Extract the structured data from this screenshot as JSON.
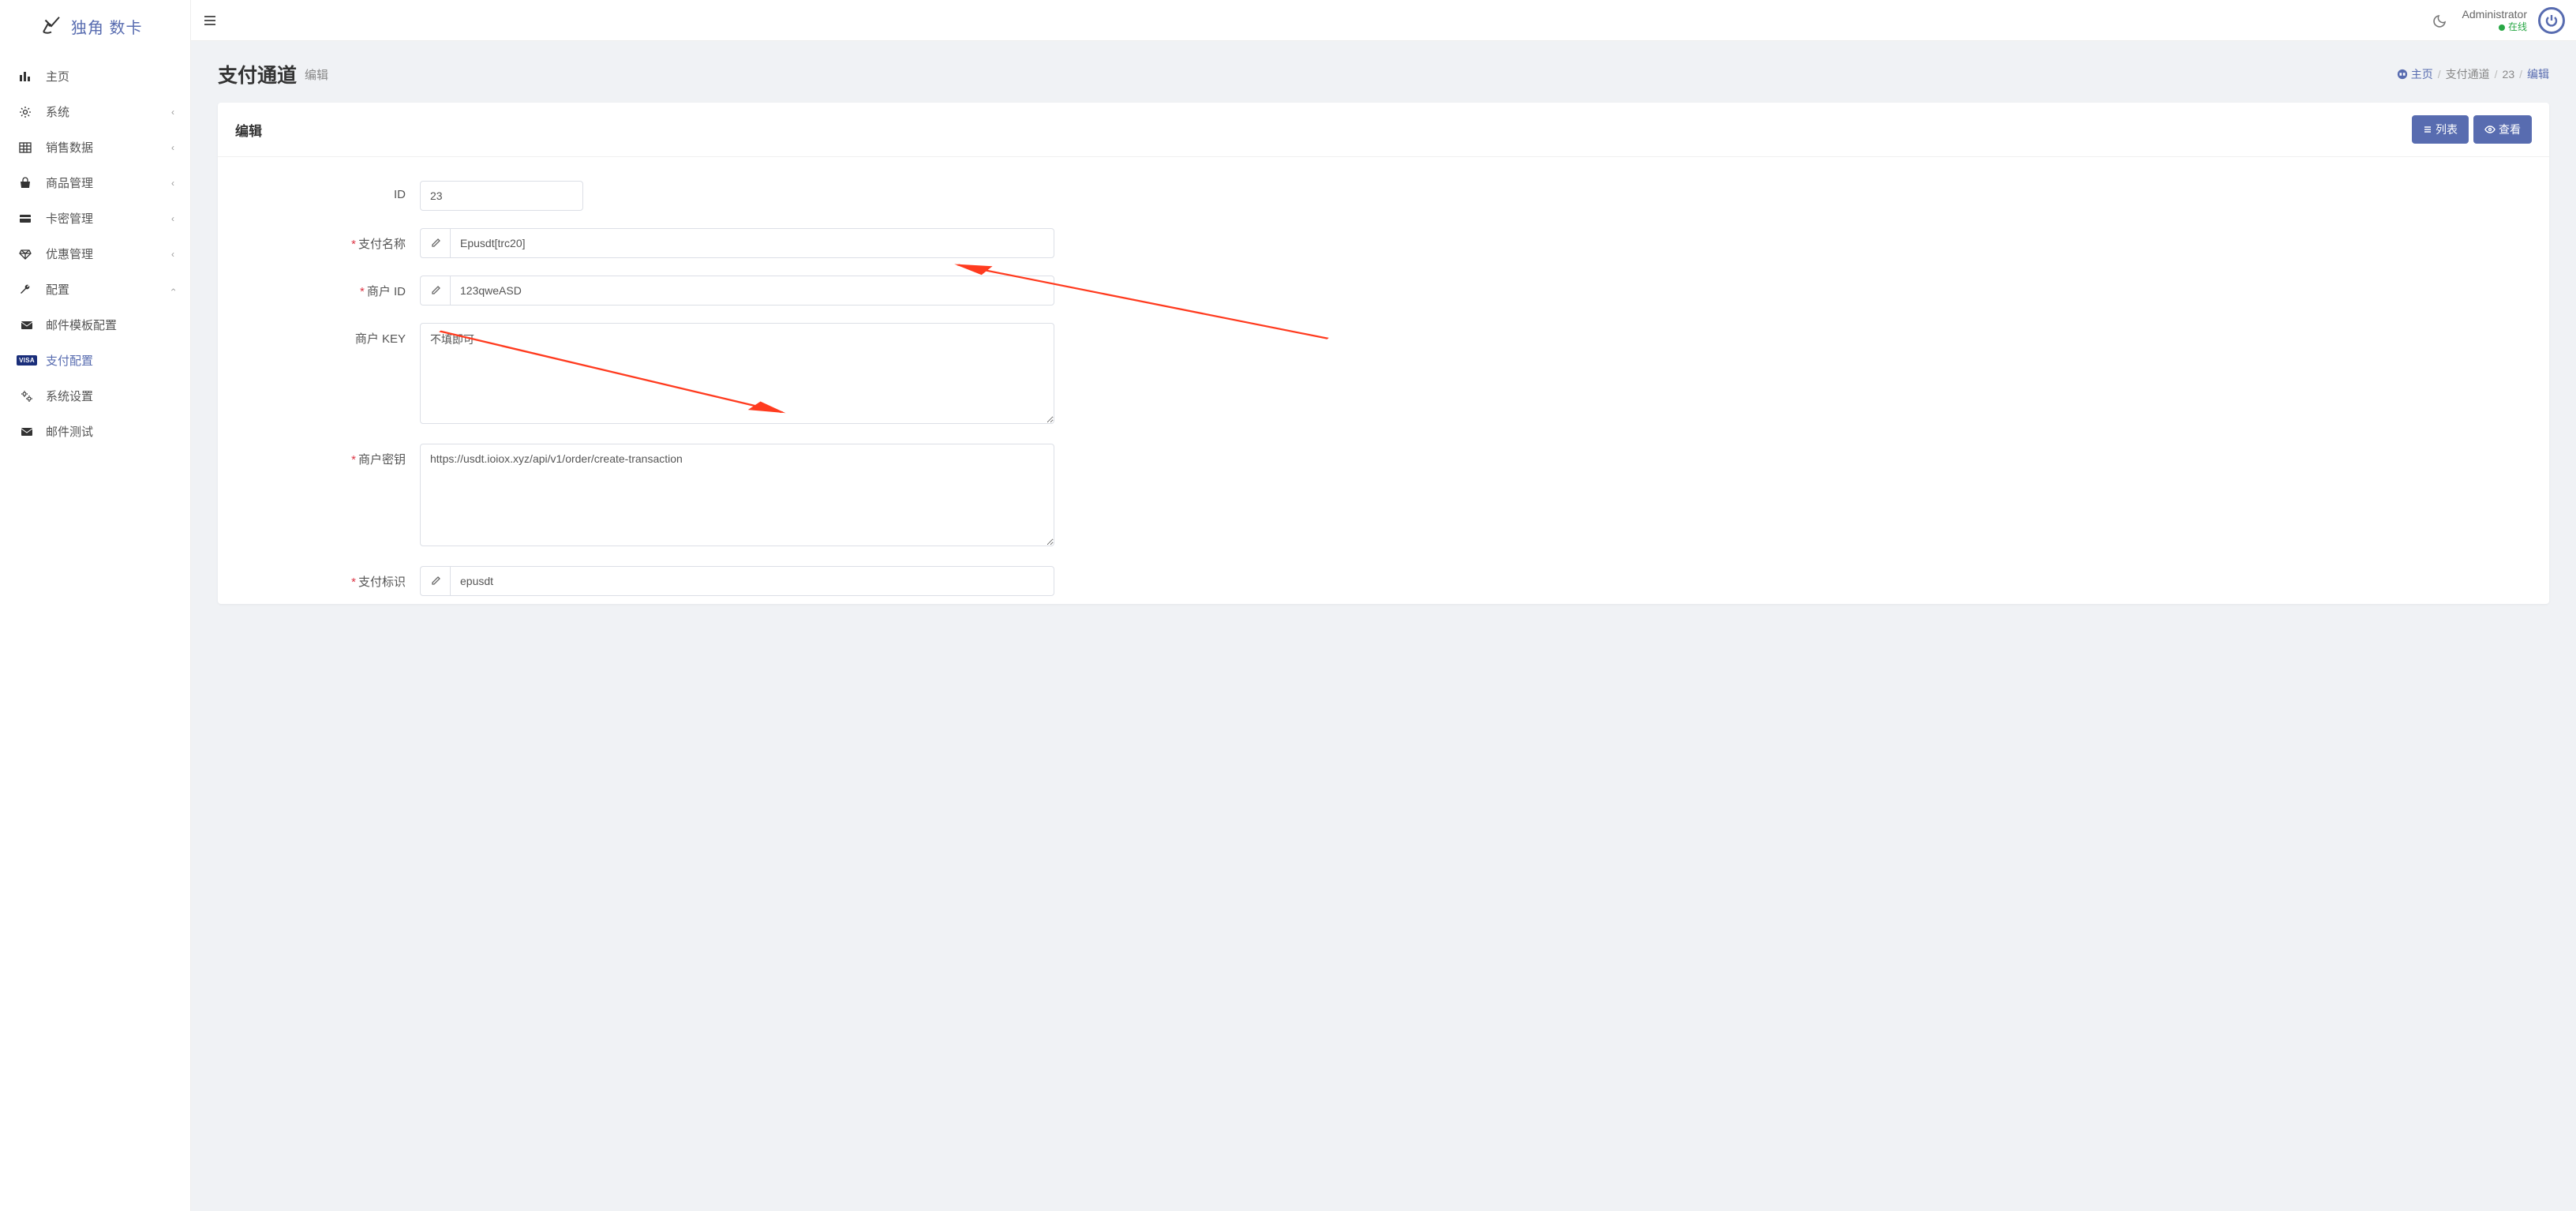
{
  "brand": "独角 数卡",
  "sidebar": {
    "items": [
      {
        "label": "主页",
        "icon": "bars"
      },
      {
        "label": "系统",
        "icon": "gear",
        "expand": true
      },
      {
        "label": "销售数据",
        "icon": "grid",
        "expand": true
      },
      {
        "label": "商品管理",
        "icon": "bag",
        "expand": true
      },
      {
        "label": "卡密管理",
        "icon": "card",
        "expand": true
      },
      {
        "label": "优惠管理",
        "icon": "diamond",
        "expand": true
      },
      {
        "label": "配置",
        "icon": "wrench",
        "expand": true,
        "open": true
      }
    ],
    "sub": [
      {
        "label": "邮件模板配置",
        "icon": "envelope"
      },
      {
        "label": "支付配置",
        "icon": "visa",
        "active": true
      },
      {
        "label": "系统设置",
        "icon": "gears"
      },
      {
        "label": "邮件测试",
        "icon": "envelope"
      }
    ]
  },
  "topbar": {
    "user_name": "Administrator",
    "status": "在线"
  },
  "page": {
    "title": "支付通道",
    "subtitle": "编辑"
  },
  "breadcrumb": {
    "home": "主页",
    "l2": "支付通道",
    "l3": "23",
    "l4": "编辑"
  },
  "card": {
    "title": "编辑",
    "btn_list": "列表",
    "btn_view": "查看"
  },
  "form": {
    "id_label": "ID",
    "id_value": "23",
    "pay_name_label": "支付名称",
    "pay_name_value": "Epusdt[trc20]",
    "merchant_id_label": "商户 ID",
    "merchant_id_value": "123qweASD",
    "merchant_key_label": "商户 KEY",
    "merchant_key_value": "不填即可",
    "merchant_secret_label": "商户密钥",
    "merchant_secret_value": "https://usdt.ioiox.xyz/api/v1/order/create-transaction",
    "pay_sign_label": "支付标识",
    "pay_sign_value": "epusdt"
  }
}
